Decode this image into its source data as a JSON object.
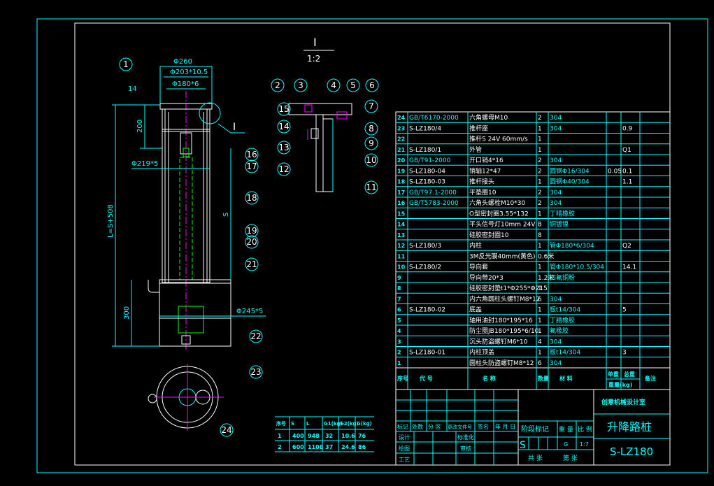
{
  "colors": {
    "frame": "#00ffff",
    "border": "#ffffff",
    "background": "#000000",
    "centerline": "#ff00ff",
    "actuator": "#00ff00"
  },
  "detail": {
    "label": "I",
    "scale": "1:2",
    "callout": "I"
  },
  "dimensions": {
    "d260": "Φ260",
    "d203": "Φ203*10.5",
    "d180": "Φ180*6",
    "t14": "14",
    "h200": "200",
    "d219": "Φ219*5",
    "len": "L=S+508",
    "stroke": "S",
    "h300": "300",
    "d245": "Φ245*5"
  },
  "balloons": [
    "1",
    "2",
    "3",
    "4",
    "5",
    "6",
    "7",
    "8",
    "9",
    "10",
    "11",
    "12",
    "13",
    "14",
    "15",
    "16",
    "17",
    "18",
    "19",
    "20",
    "21",
    "22",
    "23",
    "24"
  ],
  "parts": [
    {
      "no": "24",
      "code": "GB/T6170-2000",
      "name": "六角螺母M10",
      "qty": "2",
      "material": "304",
      "unit": "",
      "total": "",
      "note": ""
    },
    {
      "no": "23",
      "code": "S-LZ180/4",
      "name": "推杆座",
      "qty": "1",
      "material": "304",
      "unit": "",
      "total": "0.9",
      "note": ""
    },
    {
      "no": "22",
      "code": "",
      "name": "推杆S  24V  60mm/s",
      "qty": "1",
      "material": "",
      "unit": "",
      "total": "",
      "note": ""
    },
    {
      "no": "21",
      "code": "S-LZ180/1",
      "name": "外管",
      "qty": "1",
      "material": "",
      "unit": "",
      "total": "Q1",
      "note": ""
    },
    {
      "no": "20",
      "code": "GB/T91-2000",
      "name": "开口销4*16",
      "qty": "2",
      "material": "304",
      "unit": "",
      "total": "",
      "note": ""
    },
    {
      "no": "19",
      "code": "S-LZ180-04",
      "name": "销轴12*47",
      "qty": "2",
      "material": "圆钢Φ16/304",
      "unit": "0.05",
      "total": "0.1",
      "note": ""
    },
    {
      "no": "18",
      "code": "S-LZ180-03",
      "name": "推杆接头",
      "qty": "1",
      "material": "圆钢Φ40/304",
      "unit": "",
      "total": "1.1",
      "note": ""
    },
    {
      "no": "17",
      "code": "GB/T97.1-2000",
      "name": "平垫圈10",
      "qty": "2",
      "material": "304",
      "unit": "",
      "total": "",
      "note": ""
    },
    {
      "no": "16",
      "code": "GB/T5783-2000",
      "name": "六角头螺栓M10*30",
      "qty": "2",
      "material": "304",
      "unit": "",
      "total": "",
      "note": ""
    },
    {
      "no": "15",
      "code": "",
      "name": "O型密封圈3.55*132",
      "qty": "1",
      "material": "丁晴橡胶",
      "unit": "",
      "total": "",
      "note": ""
    },
    {
      "no": "14",
      "code": "",
      "name": "平头信号灯10mm 24V",
      "qty": "8",
      "material": "铜镀镍",
      "unit": "",
      "total": "",
      "note": ""
    },
    {
      "no": "13",
      "code": "",
      "name": "硅胶密封圈10",
      "qty": "8",
      "material": "",
      "unit": "",
      "total": "",
      "note": ""
    },
    {
      "no": "12",
      "code": "S-LZ180/3",
      "name": "内柱",
      "qty": "1",
      "material": "管Φ180*6/304",
      "unit": "",
      "total": "Q2",
      "note": ""
    },
    {
      "no": "11",
      "code": "",
      "name": "3M反光膜40mm(黄色)",
      "qty": "0.6米",
      "material": "",
      "unit": "",
      "total": "",
      "note": ""
    },
    {
      "no": "10",
      "code": "S-LZ180/2",
      "name": "导向套",
      "qty": "1",
      "material": "管Φ180*10.5/304",
      "unit": "",
      "total": "14.1",
      "note": ""
    },
    {
      "no": "9",
      "code": "",
      "name": "导向带20*3",
      "qty": "1.2米",
      "material": "四氟铜粉",
      "unit": "",
      "total": "",
      "note": ""
    },
    {
      "no": "8",
      "code": "",
      "name": "硅胶密封垫t1*Φ255*Φ215",
      "qty": "1",
      "material": "",
      "unit": "",
      "total": "",
      "note": ""
    },
    {
      "no": "7",
      "code": "",
      "name": "内六角圆柱头螺钉M8*12",
      "qty": "6",
      "material": "304",
      "unit": "",
      "total": "",
      "note": ""
    },
    {
      "no": "6",
      "code": "S-LZ180-02",
      "name": "底盖",
      "qty": "1",
      "material": "板t14/304",
      "unit": "",
      "total": "5",
      "note": ""
    },
    {
      "no": "5",
      "code": "",
      "name": "轴用油封180*195*16",
      "qty": "1",
      "material": "丁腈橡胶",
      "unit": "",
      "total": "",
      "note": ""
    },
    {
      "no": "4",
      "code": "",
      "name": "防尘圈JB180*195*6/10",
      "qty": "1",
      "material": "氟橡胶",
      "unit": "",
      "total": "",
      "note": ""
    },
    {
      "no": "3",
      "code": "",
      "name": "沉头防盗螺钉M6*10",
      "qty": "4",
      "material": "304",
      "unit": "",
      "total": "",
      "note": ""
    },
    {
      "no": "2",
      "code": "S-LZ180-01",
      "name": "内柱顶盖",
      "qty": "1",
      "material": "板t14/304",
      "unit": "",
      "total": "3",
      "note": ""
    },
    {
      "no": "1",
      "code": "",
      "name": "圆柱头防盗螺钉M8*12",
      "qty": "6",
      "material": "304",
      "unit": "",
      "total": "",
      "note": ""
    }
  ],
  "parts_header": {
    "no": "序号",
    "code": "代    号",
    "name": "名    称",
    "qty": "数量",
    "material": "材    料",
    "unit": "单重",
    "total": "总重",
    "weight": "重量(kg)",
    "note": "备注"
  },
  "spec_table": {
    "headers": [
      "序号",
      "S",
      "L",
      "G1(kg)",
      "G2(kg)",
      "G(kg)"
    ],
    "rows": [
      [
        "1",
        "400",
        "948",
        "32",
        "10.6",
        "76"
      ],
      [
        "2",
        "600",
        "1108",
        "37",
        "24.6",
        "86"
      ]
    ]
  },
  "title_block": {
    "labels": [
      "标记",
      "处数",
      "分 区",
      "更改文件号",
      "签名",
      "年 月 日"
    ],
    "design": "设计",
    "standard": "标准化",
    "drawing": "绘图",
    "review": "审核",
    "process": "工艺",
    "stage": "阶段标记",
    "weight": "重 量",
    "scale_label": "比 例",
    "stage_value": "S",
    "weight_value": "G",
    "scale_value": "1:7",
    "sheets": "共  张",
    "sheet": "第  张",
    "company": "创意机械设计室",
    "drawing_name": "升降路桩",
    "drawing_no": "S-LZ180"
  }
}
